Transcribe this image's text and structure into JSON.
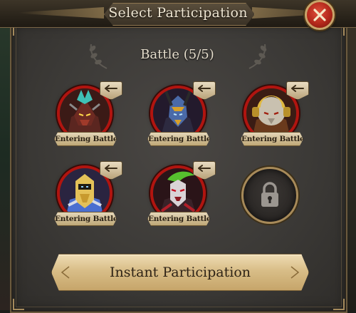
{
  "header": {
    "title": "Select Participation",
    "close_icon": "close-x-icon"
  },
  "battle": {
    "label": "Battle (5/5)"
  },
  "heroes": [
    {
      "status": "Entering Battle",
      "swap_icon": "swap-arrow-icon",
      "accent": "#3fc1b5"
    },
    {
      "status": "Entering Battle",
      "swap_icon": "swap-arrow-icon",
      "accent": "#d7a02a"
    },
    {
      "status": "Entering Battle",
      "swap_icon": "swap-arrow-icon",
      "accent": "#e0b840"
    },
    {
      "status": "Entering Battle",
      "swap_icon": "swap-arrow-icon",
      "accent": "#4a6fd0"
    },
    {
      "status": "Entering Battle",
      "swap_icon": "swap-arrow-icon",
      "accent": "#56c02e"
    }
  ],
  "locked_slot": {
    "icon": "padlock-icon"
  },
  "actions": {
    "instant_participation": "Instant Participation"
  },
  "colors": {
    "portrait_ring": "#b1140f",
    "gold": "#c9a46a",
    "close_red": "#b3281b"
  }
}
